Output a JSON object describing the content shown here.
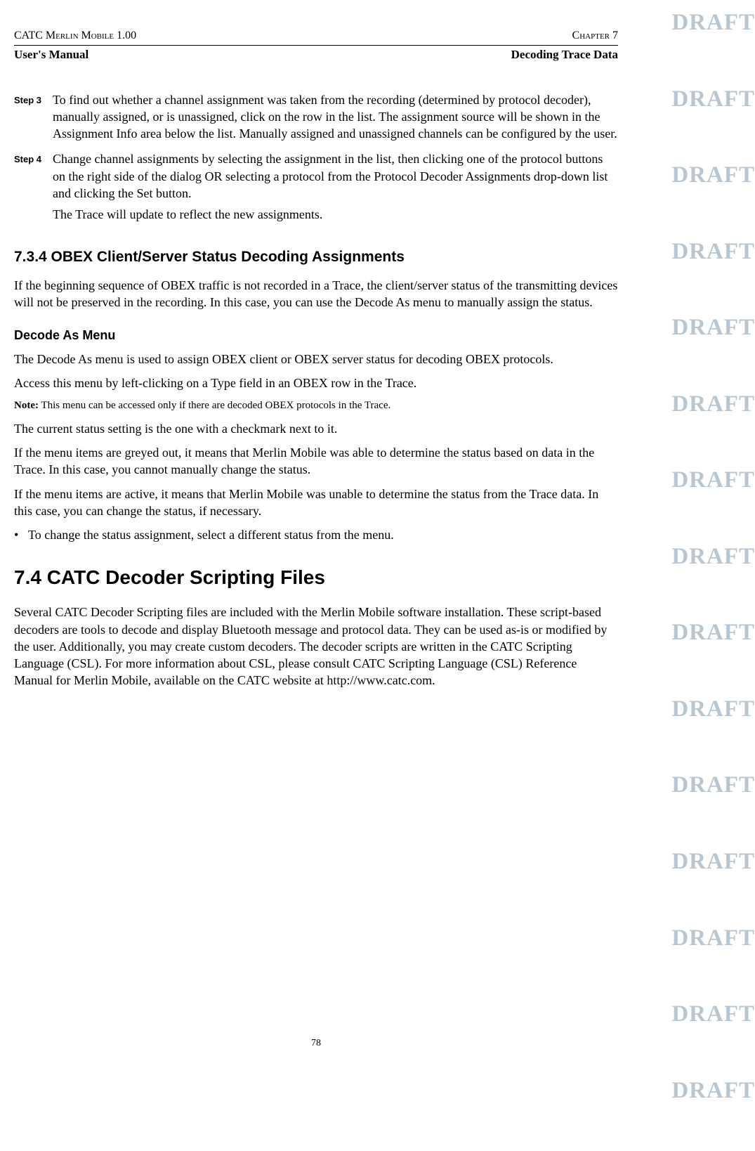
{
  "header": {
    "left": "CATC Merlin Mobile 1.00",
    "right": "Chapter 7",
    "sub_left": "User's Manual",
    "sub_right": "Decoding Trace Data"
  },
  "steps": {
    "s3_label": "Step 3",
    "s3_text": "To find out whether a channel assignment was taken from the recording (determined by protocol decoder), manually assigned, or is unassigned, click on the row in the list. The assignment source will be shown in the Assignment Info area below the list. Manually assigned and unassigned channels can be configured by the user.",
    "s4_label": "Step 4",
    "s4_text1": "Change channel assignments by selecting the assignment in the list, then clicking one of the protocol buttons on the right side of the dialog OR selecting a protocol from the Protocol Decoder Assignments drop-down list and clicking the Set button.",
    "s4_text2": "The Trace will update to reflect the new assignments."
  },
  "h734": "7.3.4 OBEX Client/Server Status Decoding Assignments",
  "p734": "If the beginning sequence of OBEX traffic is not recorded in a Trace, the client/server status of the transmitting devices will not be preserved in the recording. In this case, you can use the Decode As menu to manually assign the status.",
  "h_decode": "Decode As Menu",
  "p_decode1": "The Decode As menu is used to assign OBEX client or OBEX server status for decoding OBEX protocols.",
  "p_decode2": "Access this menu by left-clicking on a Type field in an OBEX row in the Trace.",
  "note_label": "Note:",
  "note_text": "This menu can be accessed only if there are decoded OBEX protocols in the Trace.",
  "p_status1": "The current status setting is the one with a checkmark next to it.",
  "p_status2": "If the menu items are greyed out, it means that Merlin Mobile was able to determine the status based on data in the Trace. In this case, you cannot manually change the status.",
  "p_status3": "If the menu items are active, it means that Merlin Mobile was unable to determine the status from the Trace data. In this case, you can change the status, if necessary.",
  "bullet1": "To change the status assignment, select a different status from the menu.",
  "h74": "7.4  CATC Decoder Scripting Files",
  "p74": "Several CATC Decoder Scripting files are included with the Merlin Mobile software installation. These script-based decoders are tools to decode and display Bluetooth message and protocol data. They can be used as-is or modified by the user. Additionally, you may create custom decoders. The decoder scripts are written in the CATC Scripting Language (CSL). For more information about CSL, please consult CATC Scripting Language (CSL) Reference Manual for Merlin Mobile, available on the CATC website at http://www.catc.com.",
  "draft": "DRAFT",
  "page_number": "78"
}
